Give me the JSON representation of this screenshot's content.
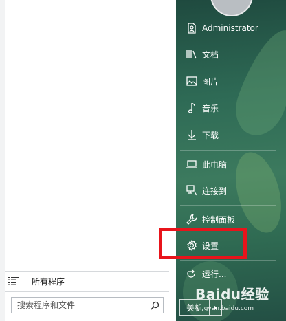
{
  "left": {
    "all_programs_label": "所有程序",
    "search": {
      "placeholder": "搜索程序和文件"
    }
  },
  "right": {
    "items": [
      {
        "label": "Administrator",
        "icon": "user-icon"
      },
      {
        "label": "文档",
        "icon": "library-icon"
      },
      {
        "label": "图片",
        "icon": "picture-icon"
      },
      {
        "label": "音乐",
        "icon": "music-note-icon"
      },
      {
        "label": "下载",
        "icon": "download-icon"
      },
      {
        "label": "此电脑",
        "icon": "computer-icon"
      },
      {
        "label": "连接到",
        "icon": "connect-icon"
      },
      {
        "label": "控制面板",
        "icon": "wrench-icon"
      },
      {
        "label": "设置",
        "icon": "gear-icon"
      },
      {
        "label": "运行...",
        "icon": "run-icon"
      }
    ],
    "shutdown_label": "关机"
  },
  "annotation": {
    "highlight_color": "#e8141b"
  },
  "watermark": {
    "text": "Baidu经验",
    "sub": "jingyan.baidu.com"
  }
}
